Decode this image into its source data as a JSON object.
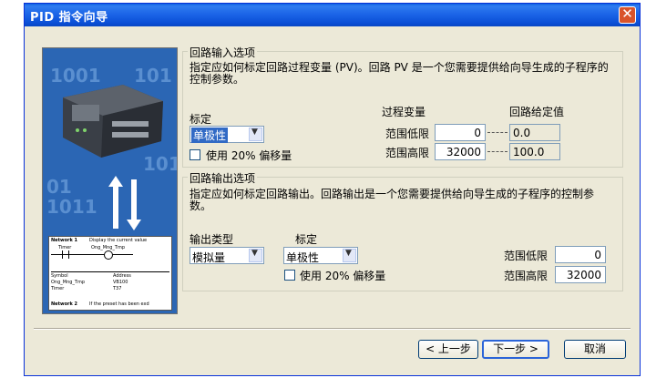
{
  "window": {
    "title": "PID 指令向导",
    "close_glyph": "✕"
  },
  "image_panel": {
    "numbers_text": "1001",
    "numbers_text2": "101",
    "numbers_text3": "01",
    "numbers_text4": "1011",
    "ladder_network1": "Network 1",
    "ladder_network1_desc": "Display the current value",
    "ladder_timer": "Timer",
    "ladder_ong": "Ong_Mng_Tmp",
    "ladder_symbol": "Symbol",
    "ladder_address": "Address",
    "ladder_row1a": "Ong_Mng_Tmp",
    "ladder_row1b": "VB100",
    "ladder_row2a": "Timer",
    "ladder_row2b": "T37",
    "ladder_network2": "Network 2",
    "ladder_network2_desc": "If the preset has been exd"
  },
  "input_group": {
    "title": "回路输入选项",
    "description": "指定应如何标定回路过程变量 (PV)。回路 PV 是一个您需要提供给向导生成的子程序的控制参数。",
    "scale_label": "标定",
    "scale_value": "单极性",
    "bias_label": "使用 20% 偏移量",
    "pv_header": "过程变量",
    "setpoint_header": "回路给定值",
    "low_label": "范围低限",
    "high_label": "范围高限",
    "pv_low": "0",
    "pv_high": "32000",
    "sp_low": "0.0",
    "sp_high": "100.0"
  },
  "output_group": {
    "title": "回路输出选项",
    "description": "指定应如何标定回路输出。回路输出是一个您需要提供给向导生成的子程序的控制参数。",
    "type_label": "输出类型",
    "type_value": "模拟量",
    "scale_label": "标定",
    "scale_value": "单极性",
    "bias_label": "使用 20% 偏移量",
    "low_label": "范围低限",
    "high_label": "范围高限",
    "low_value": "0",
    "high_value": "32000"
  },
  "buttons": {
    "prev": "< 上一步",
    "next": "下一步 >",
    "cancel": "取消"
  }
}
